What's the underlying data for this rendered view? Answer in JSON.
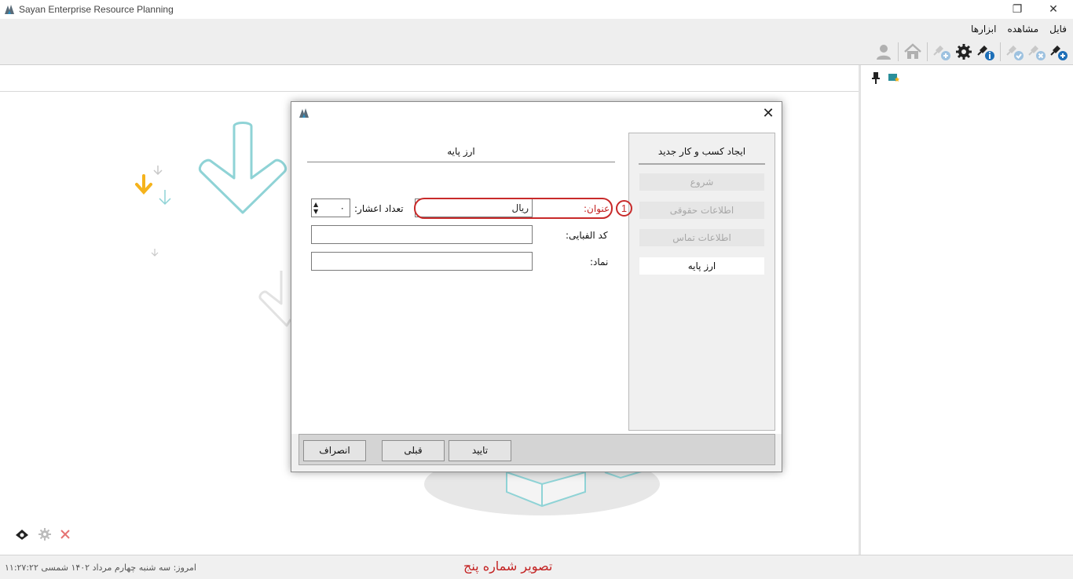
{
  "window": {
    "title": "Sayan Enterprise Resource Planning",
    "restore_glyph": "❐",
    "close_glyph": "✕"
  },
  "menu": {
    "items": [
      "فایل",
      "مشاهده",
      "ابزارها"
    ]
  },
  "toolbar": {
    "icons": [
      "plug-add-icon",
      "plug-remove-icon",
      "plug-check-icon",
      "plug-info-icon",
      "gear-icon",
      "plug-add-gray-icon",
      "home-icon",
      "user-icon"
    ]
  },
  "dialog": {
    "close_glyph": "✕",
    "wizard": {
      "title": "ایجاد کسب و کار جدید",
      "steps": [
        {
          "label": "شروع",
          "active": false
        },
        {
          "label": "اطلاعات حقوقی",
          "active": false
        },
        {
          "label": "اطلاعات تماس",
          "active": false
        },
        {
          "label": "ارز پایه",
          "active": true
        }
      ]
    },
    "section_title": "ارز پایه",
    "fields": {
      "title_label": "عنوان:",
      "title_value": "ریال",
      "decimals_label": "تعداد اعشار:",
      "decimals_value": "۰",
      "code_label": "کد الفبایی:",
      "code_value": "",
      "symbol_label": "نماد:",
      "symbol_value": ""
    },
    "annotation_number": "1",
    "buttons": {
      "confirm": "تایید",
      "previous": "قبلی",
      "cancel": "انصراف"
    }
  },
  "status": {
    "date_text": "امروز: سه شنبه چهارم مرداد ۱۴۰۲ شمسی ۱۱:۲۷:۲۲",
    "caption": "تصویر شماره پنج"
  },
  "colors": {
    "accent_red": "#c32020",
    "arrow_yellow": "#f5b31c",
    "arrow_teal": "#8fd3d6"
  }
}
